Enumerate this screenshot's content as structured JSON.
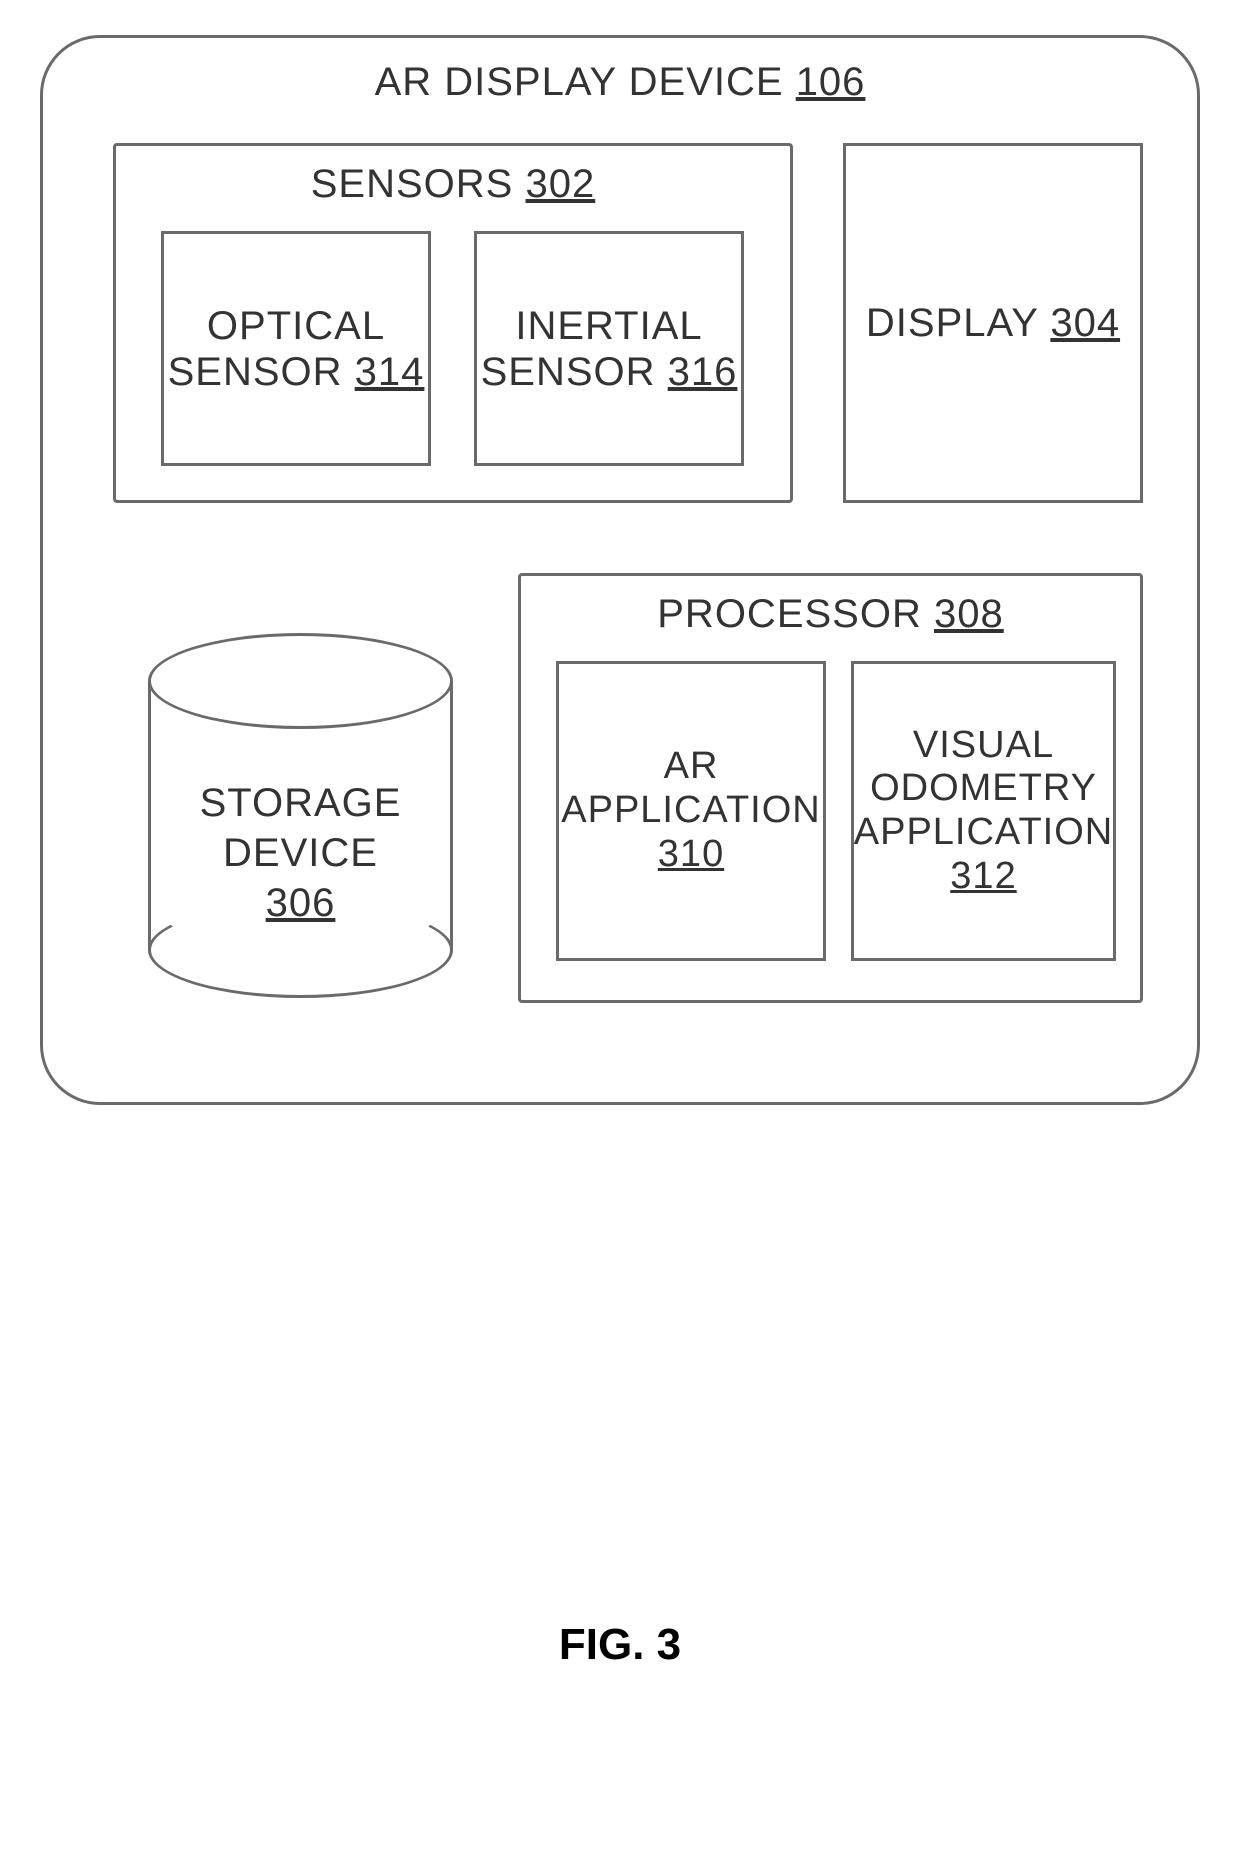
{
  "outer": {
    "title": "AR DISPLAY DEVICE",
    "ref": "106"
  },
  "sensors": {
    "title": "SENSORS",
    "ref": "302"
  },
  "optical": {
    "line1": "OPTICAL",
    "line2": "SENSOR",
    "ref": "314"
  },
  "inertial": {
    "line1": "INERTIAL",
    "line2": "SENSOR",
    "ref": "316"
  },
  "display": {
    "title": "DISPLAY",
    "ref": "304"
  },
  "processor": {
    "title": "PROCESSOR",
    "ref": "308"
  },
  "ar_app": {
    "line1": "AR",
    "line2": "APPLICATION",
    "ref": "310"
  },
  "vo_app": {
    "line1": "VISUAL",
    "line2": "ODOMETRY",
    "line3": "APPLICATION",
    "ref": "312"
  },
  "storage": {
    "line1": "STORAGE DEVICE",
    "ref": "306"
  },
  "figure_caption": "FIG. 3"
}
